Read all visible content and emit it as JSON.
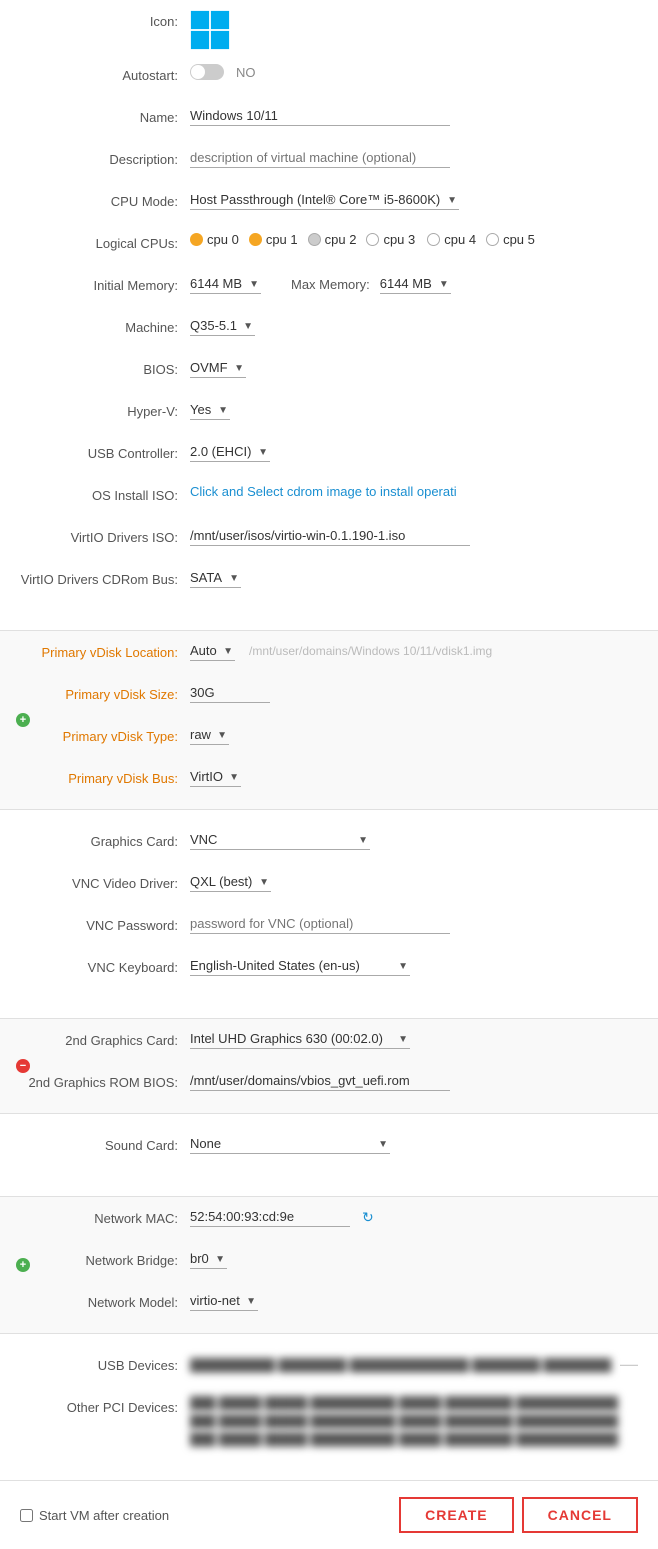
{
  "form": {
    "icon_label": "Icon:",
    "autostart_label": "Autostart:",
    "autostart_value": "NO",
    "name_label": "Name:",
    "name_value": "Windows 10/11",
    "description_label": "Description:",
    "description_placeholder": "description of virtual machine (optional)",
    "cpu_mode_label": "CPU Mode:",
    "cpu_mode_value": "Host Passthrough (Intel® Core™ i5-8600K)",
    "logical_cpus_label": "Logical CPUs:",
    "cpus": [
      {
        "id": "cpu 0",
        "active": true,
        "color": "orange"
      },
      {
        "id": "cpu 1",
        "active": true,
        "color": "orange"
      },
      {
        "id": "cpu 2",
        "active": false,
        "color": "gray"
      },
      {
        "id": "cpu 3",
        "active": false,
        "color": "empty"
      },
      {
        "id": "cpu 4",
        "active": false,
        "color": "empty"
      },
      {
        "id": "cpu 5",
        "active": false,
        "color": "empty"
      }
    ],
    "initial_memory_label": "Initial Memory:",
    "initial_memory_value": "6144 MB",
    "max_memory_label": "Max Memory:",
    "max_memory_value": "6144 MB",
    "machine_label": "Machine:",
    "machine_value": "Q35-5.1",
    "bios_label": "BIOS:",
    "bios_value": "OVMF",
    "hyperv_label": "Hyper-V:",
    "hyperv_value": "Yes",
    "usb_controller_label": "USB Controller:",
    "usb_controller_value": "2.0 (EHCI)",
    "os_install_label": "OS Install ISO:",
    "os_install_placeholder": "Click and Select cdrom image to install operati",
    "virtio_drivers_label": "VirtIO Drivers ISO:",
    "virtio_drivers_value": "/mnt/user/isos/virtio-win-0.1.190-1.iso",
    "virtio_cdrom_bus_label": "VirtIO Drivers CDRom Bus:",
    "virtio_cdrom_bus_value": "SATA",
    "primary_vdisk_location_label": "Primary vDisk Location:",
    "primary_vdisk_location_value": "Auto",
    "primary_vdisk_path": "/mnt/user/domains/Windows 10/11/vdisk1.img",
    "primary_vdisk_size_label": "Primary vDisk Size:",
    "primary_vdisk_size_value": "30G",
    "primary_vdisk_type_label": "Primary vDisk Type:",
    "primary_vdisk_type_value": "raw",
    "primary_vdisk_bus_label": "Primary vDisk Bus:",
    "primary_vdisk_bus_value": "VirtIO",
    "graphics_card_label": "Graphics Card:",
    "graphics_card_value": "VNC",
    "vnc_video_driver_label": "VNC Video Driver:",
    "vnc_video_driver_value": "QXL (best)",
    "vnc_password_label": "VNC Password:",
    "vnc_password_placeholder": "password for VNC (optional)",
    "vnc_keyboard_label": "VNC Keyboard:",
    "vnc_keyboard_value": "English-United States (en-us)",
    "second_graphics_card_label": "2nd Graphics Card:",
    "second_graphics_card_value": "Intel UHD Graphics 630 (00:02.0)",
    "second_graphics_rom_label": "2nd Graphics ROM BIOS:",
    "second_graphics_rom_value": "/mnt/user/domains/vbios_gvt_uefi.rom",
    "sound_card_label": "Sound Card:",
    "sound_card_value": "None",
    "network_mac_label": "Network MAC:",
    "network_mac_value": "52:54:00:93:cd:9e",
    "network_bridge_label": "Network Bridge:",
    "network_bridge_value": "br0",
    "network_model_label": "Network Model:",
    "network_model_value": "virtio-net",
    "usb_devices_label": "USB Devices:",
    "other_pci_label": "Other PCI Devices:",
    "start_vm_label": "Start VM after creation",
    "create_btn": "CREATE",
    "cancel_btn": "CANCEL"
  }
}
